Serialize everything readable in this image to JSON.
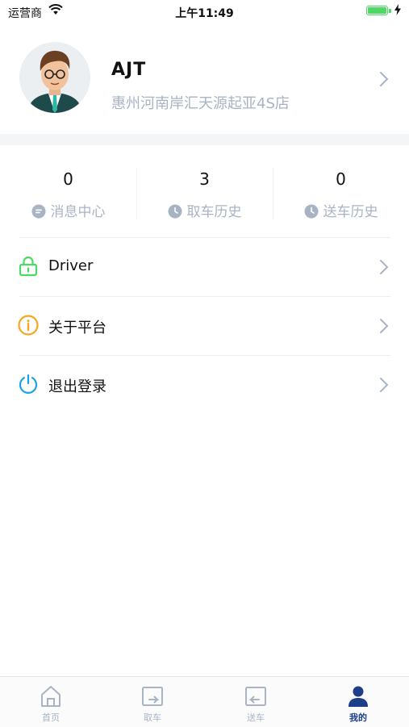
{
  "status_bar": {
    "carrier": "运营商",
    "time": "上午11:49"
  },
  "profile": {
    "name": "AJT",
    "shop": "惠州河南岸汇天源起亚4S店"
  },
  "stats": [
    {
      "value": "0",
      "label": "消息中心",
      "icon": "message-icon"
    },
    {
      "value": "3",
      "label": "取车历史",
      "icon": "clock-icon"
    },
    {
      "value": "0",
      "label": "送车历史",
      "icon": "clock-icon"
    }
  ],
  "menu": [
    {
      "label": "Driver",
      "icon": "lock-icon",
      "color": "#4cd964"
    },
    {
      "label": "关于平台",
      "icon": "info-icon",
      "color": "#f5a623"
    },
    {
      "label": "退出登录",
      "icon": "power-icon",
      "color": "#1aa1e8"
    }
  ],
  "tabs": [
    {
      "label": "首页",
      "icon": "home-icon",
      "active": false
    },
    {
      "label": "取车",
      "icon": "pickup-icon",
      "active": false
    },
    {
      "label": "送车",
      "icon": "delivery-icon",
      "active": false
    },
    {
      "label": "我的",
      "icon": "user-icon",
      "active": true
    }
  ],
  "colors": {
    "accent": "#1d3f8a",
    "muted": "#a8b4c4"
  }
}
